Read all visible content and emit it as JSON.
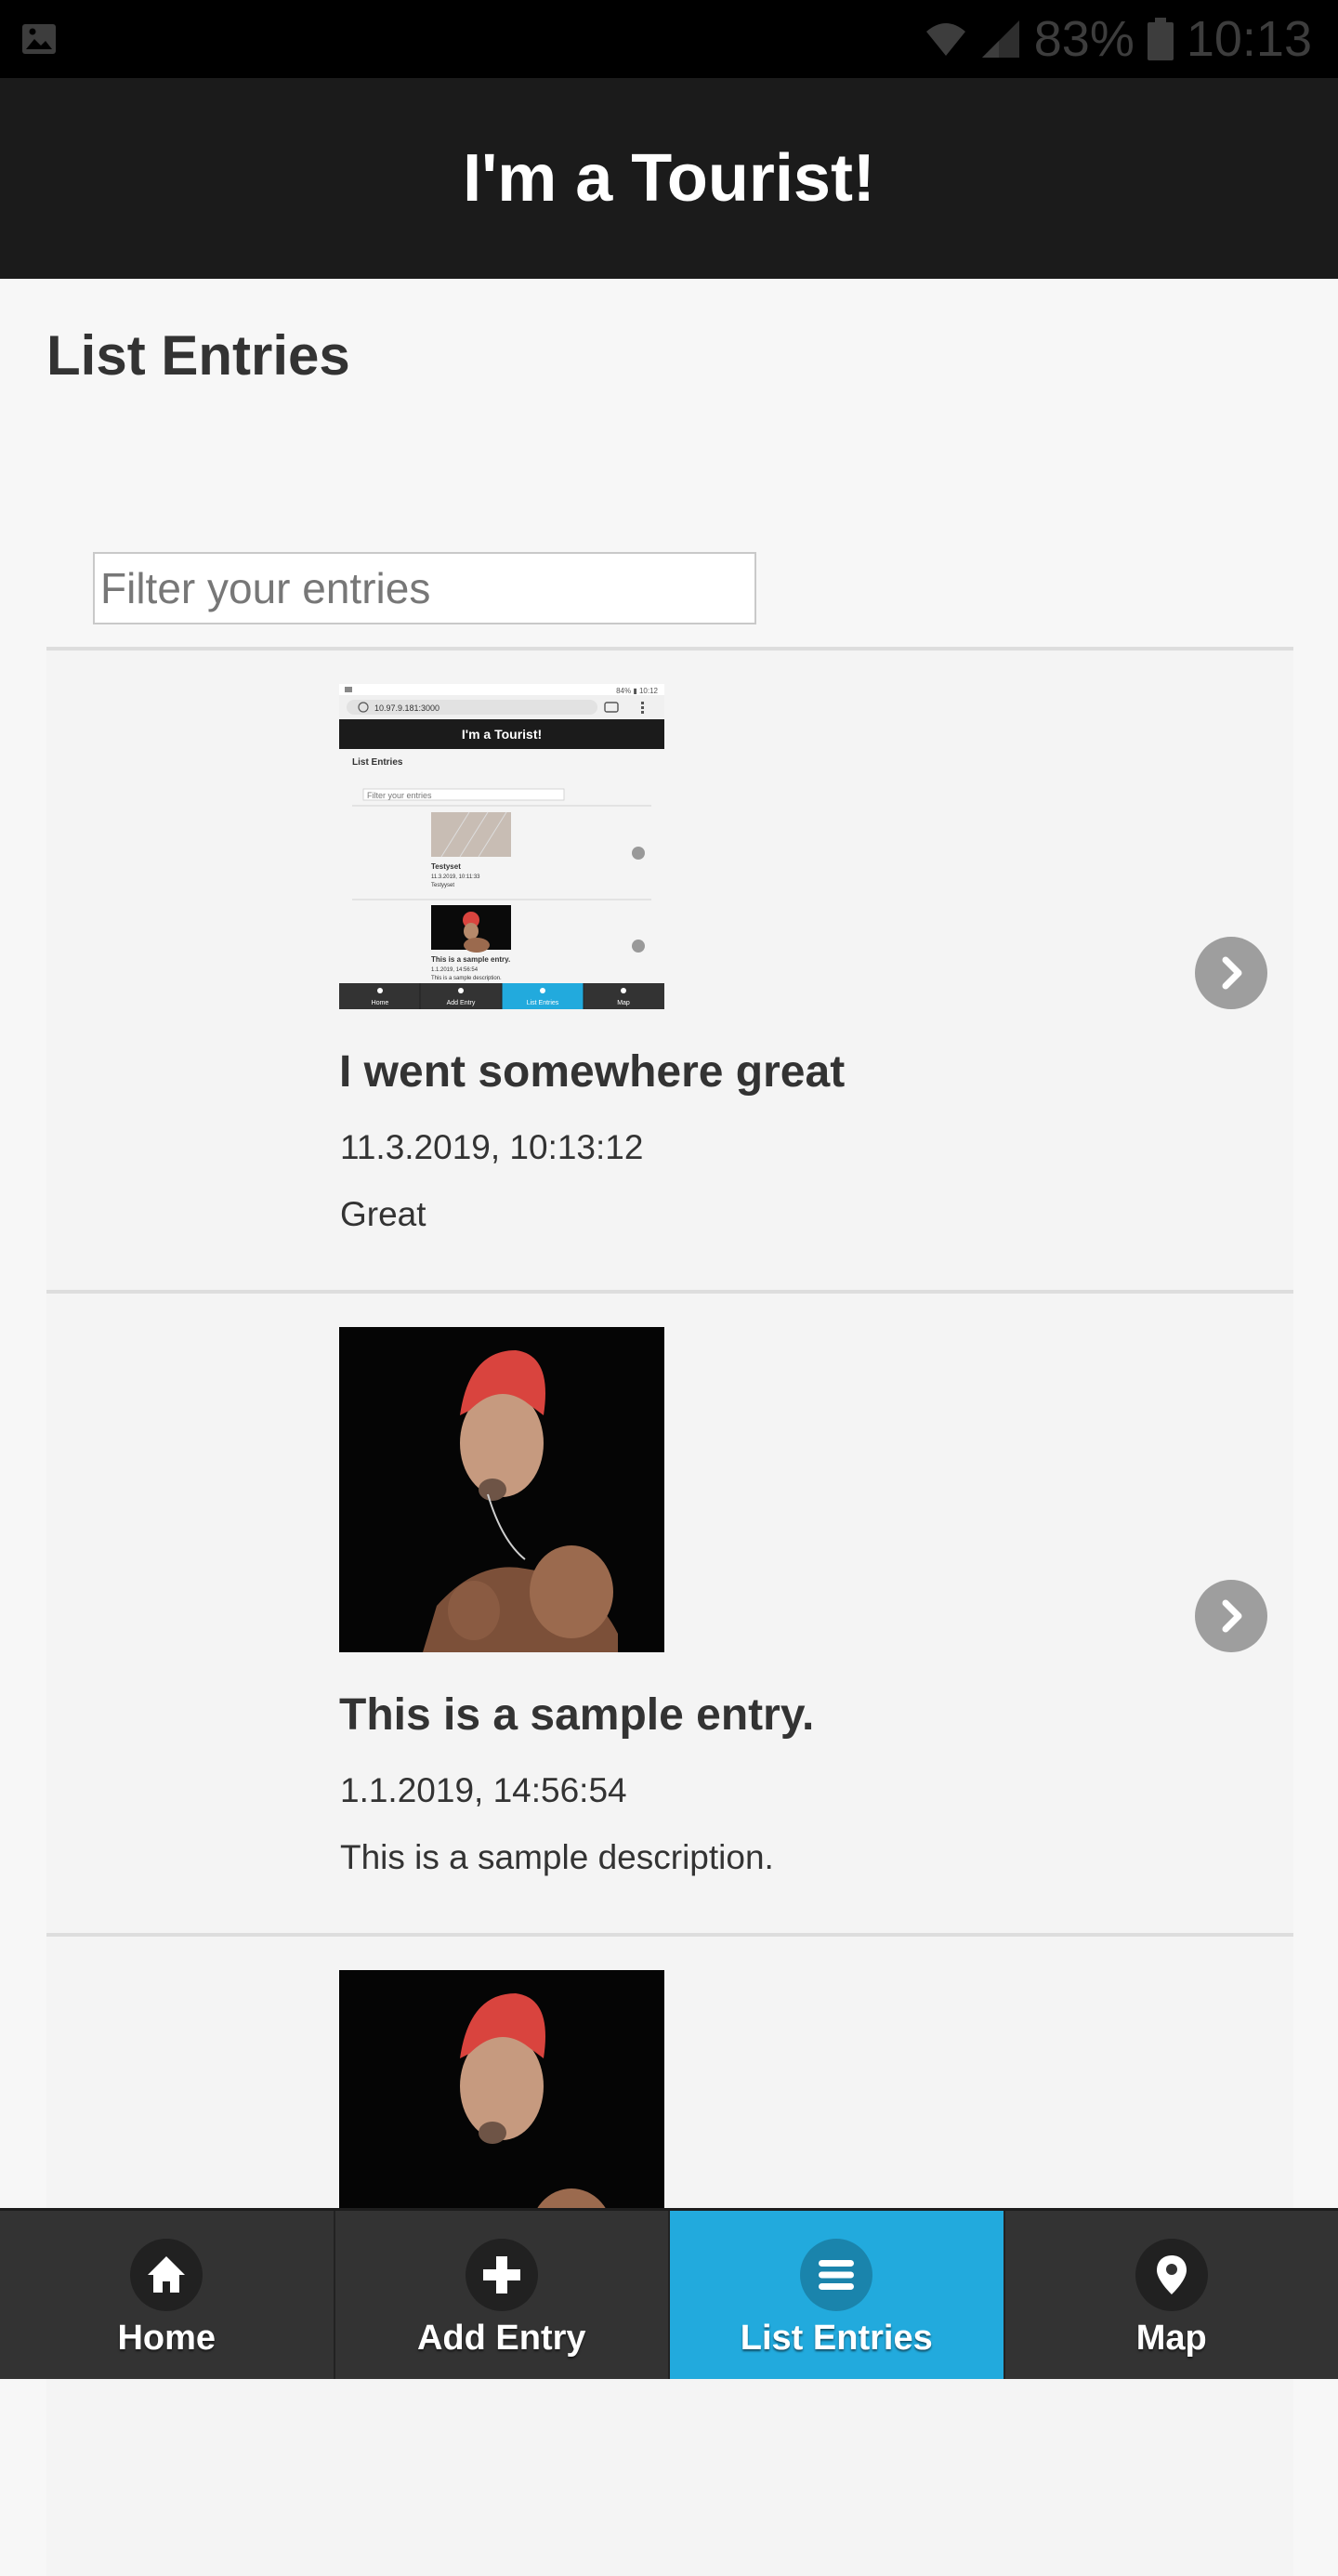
{
  "status_bar": {
    "battery": "83%",
    "time": "10:13"
  },
  "header": {
    "title": "I'm a Tourist!"
  },
  "page": {
    "title": "List Entries",
    "filter_placeholder": "Filter your entries"
  },
  "entries": [
    {
      "title": "I went somewhere great",
      "date": "11.3.2019, 10:13:12",
      "description": "Great"
    },
    {
      "title": "This is a sample entry.",
      "date": "1.1.2019, 14:56:54",
      "description": "This is a sample description."
    },
    {
      "title": "",
      "date": "",
      "description": ""
    }
  ],
  "thumb_screenshot": {
    "status": "84% ▮ 10:12",
    "url": "10.97.9.181:3000",
    "header": "I'm a Tourist!",
    "title": "List Entries",
    "filter": "Filter your entries",
    "items": [
      {
        "title": "Testyset",
        "date": "11.3.2019, 10:11:33",
        "desc": "Testyyset"
      },
      {
        "title": "This is a sample entry.",
        "date": "1.1.2019, 14:56:54",
        "desc": "This is a sample description."
      }
    ],
    "nav": [
      "Home",
      "Add Entry",
      "List Entries",
      "Map"
    ]
  },
  "nav": {
    "items": [
      {
        "label": "Home",
        "icon": "home-icon"
      },
      {
        "label": "Add Entry",
        "icon": "plus-icon"
      },
      {
        "label": "List Entries",
        "icon": "list-icon",
        "active": true
      },
      {
        "label": "Map",
        "icon": "map-pin-icon"
      }
    ]
  },
  "colors": {
    "header_bg": "#1b1b1b",
    "nav_bg": "#333333",
    "nav_active": "#22aadd",
    "arrow_button": "#9e9e9e"
  }
}
